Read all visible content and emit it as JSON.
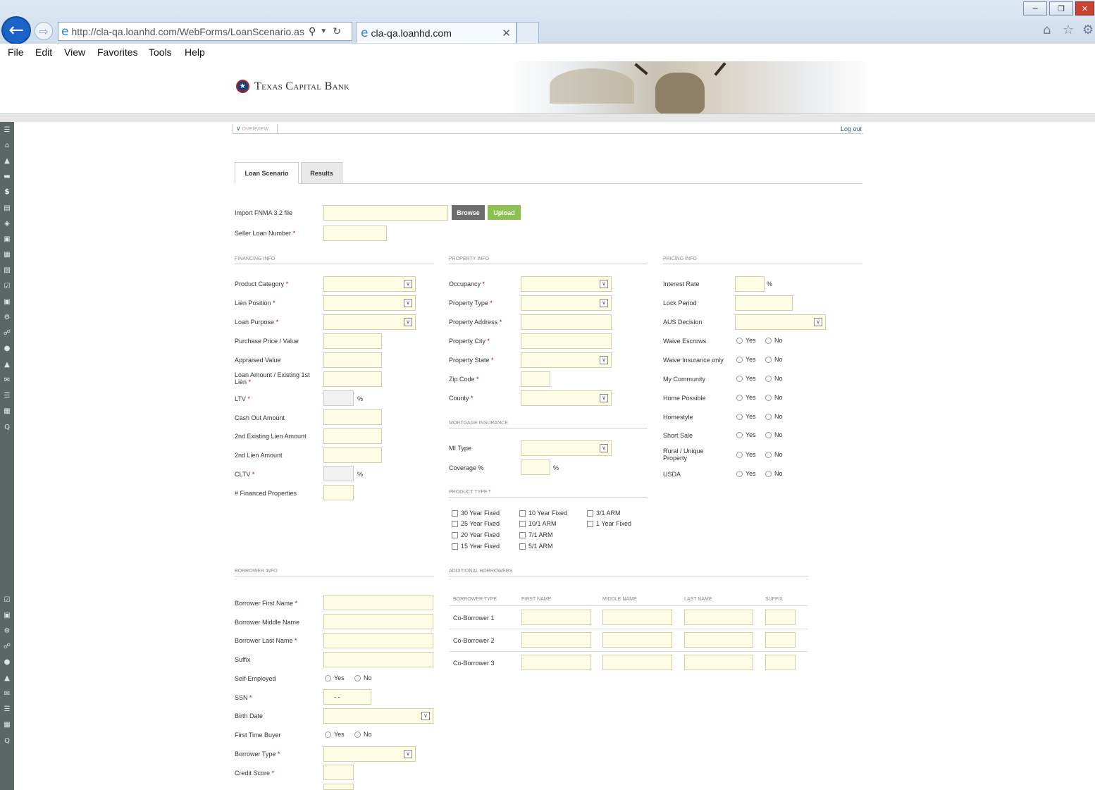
{
  "browser": {
    "url": "http://cla-qa.loanhd.com/WebForms/LoanScenario.as",
    "tab_title": "cla-qa.loanhd.com",
    "menu": [
      "File",
      "Edit",
      "View",
      "Favorites",
      "Tools",
      "Help"
    ]
  },
  "header": {
    "logo_text": "Texas Capital Bank",
    "overview": "OVERVIEW",
    "logout": "Log out"
  },
  "tabs": [
    "Loan Scenario",
    "Results"
  ],
  "import": {
    "label": "Import FNMA 3.2 file",
    "browse": "Browse",
    "upload": "Upload",
    "seller_label": "Seller Loan Number"
  },
  "financing": {
    "title": "FINANCING INFO",
    "fields": [
      "Product Category",
      "Lien Position",
      "Loan Purpose",
      "Purchase Price / Value",
      "Appraised Value",
      "Loan Amount / Existing 1st Lien",
      "LTV",
      "Cash Out Amount",
      "2nd Existing Lien Amount",
      "2nd Lien Amount",
      "CLTV",
      "# Financed Properties"
    ]
  },
  "property": {
    "title": "PROPERTY INFO",
    "fields": [
      "Occupancy",
      "Property Type",
      "Property Address",
      "Property City",
      "Property State",
      "Zip Code",
      "County"
    ]
  },
  "mortgage_insurance": {
    "title": "MORTGAGE INSURANCE",
    "fields": [
      "MI Type",
      "Coverage %"
    ]
  },
  "product_type": {
    "title": "PRODUCT TYPE",
    "options": [
      "30 Year Fixed",
      "25 Year Fixed",
      "20 Year Fixed",
      "15 Year Fixed",
      "10 Year Fixed",
      "10/1 ARM",
      "7/1 ARM",
      "5/1 ARM",
      "3/1 ARM",
      "1 Year Fixed"
    ]
  },
  "pricing": {
    "title": "PRICING INFO",
    "fields": [
      "Interest Rate",
      "Lock Period",
      "AUS Decision"
    ],
    "yes_no": [
      "Waive Escrows",
      "Waive Insurance only",
      "My Community",
      "Home Possible",
      "Homestyle",
      "Short Sale",
      "Rural / Unique Property",
      "USDA"
    ]
  },
  "borrower": {
    "title": "BORROWER INFO",
    "fields": [
      "Borrower First Name",
      "Borrower Middle Name",
      "Borrower Last Name",
      "Suffix",
      "Self-Employed",
      "SSN",
      "Birth Date",
      "First Time Buyer",
      "Borrower Type",
      "Credit Score"
    ],
    "ssn_value": "- -"
  },
  "additional": {
    "title": "ADDITIONAL BORROWERS",
    "columns": [
      "BORROWER TYPE",
      "FIRST NAME",
      "MIDDLE NAME",
      "LAST NAME",
      "SUFFIX"
    ],
    "rows": [
      "Co-Borrower 1",
      "Co-Borrower 2",
      "Co-Borrower 3"
    ]
  },
  "common": {
    "yes": "Yes",
    "no": "No",
    "pct": "%",
    "req": "*"
  }
}
